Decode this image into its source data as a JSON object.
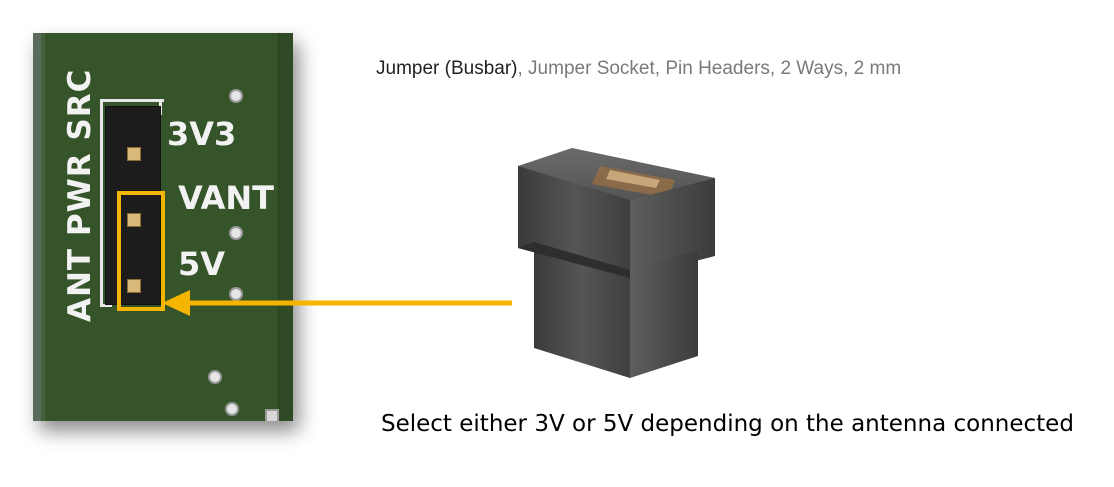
{
  "pcb": {
    "silkscreen_vertical": "ANT PWR SRC",
    "labels": [
      "3V3",
      "VANT",
      "5V"
    ]
  },
  "product": {
    "title_main": "Jumper (Busbar)",
    "title_rest": ", Jumper Socket, Pin Headers, 2 Ways, 2 mm"
  },
  "caption": "Select either 3V or 5V depending on the antenna connected",
  "colors": {
    "pcb_green": "#35542a",
    "highlight": "#f5b400",
    "silkscreen": "#f2f2f2"
  }
}
